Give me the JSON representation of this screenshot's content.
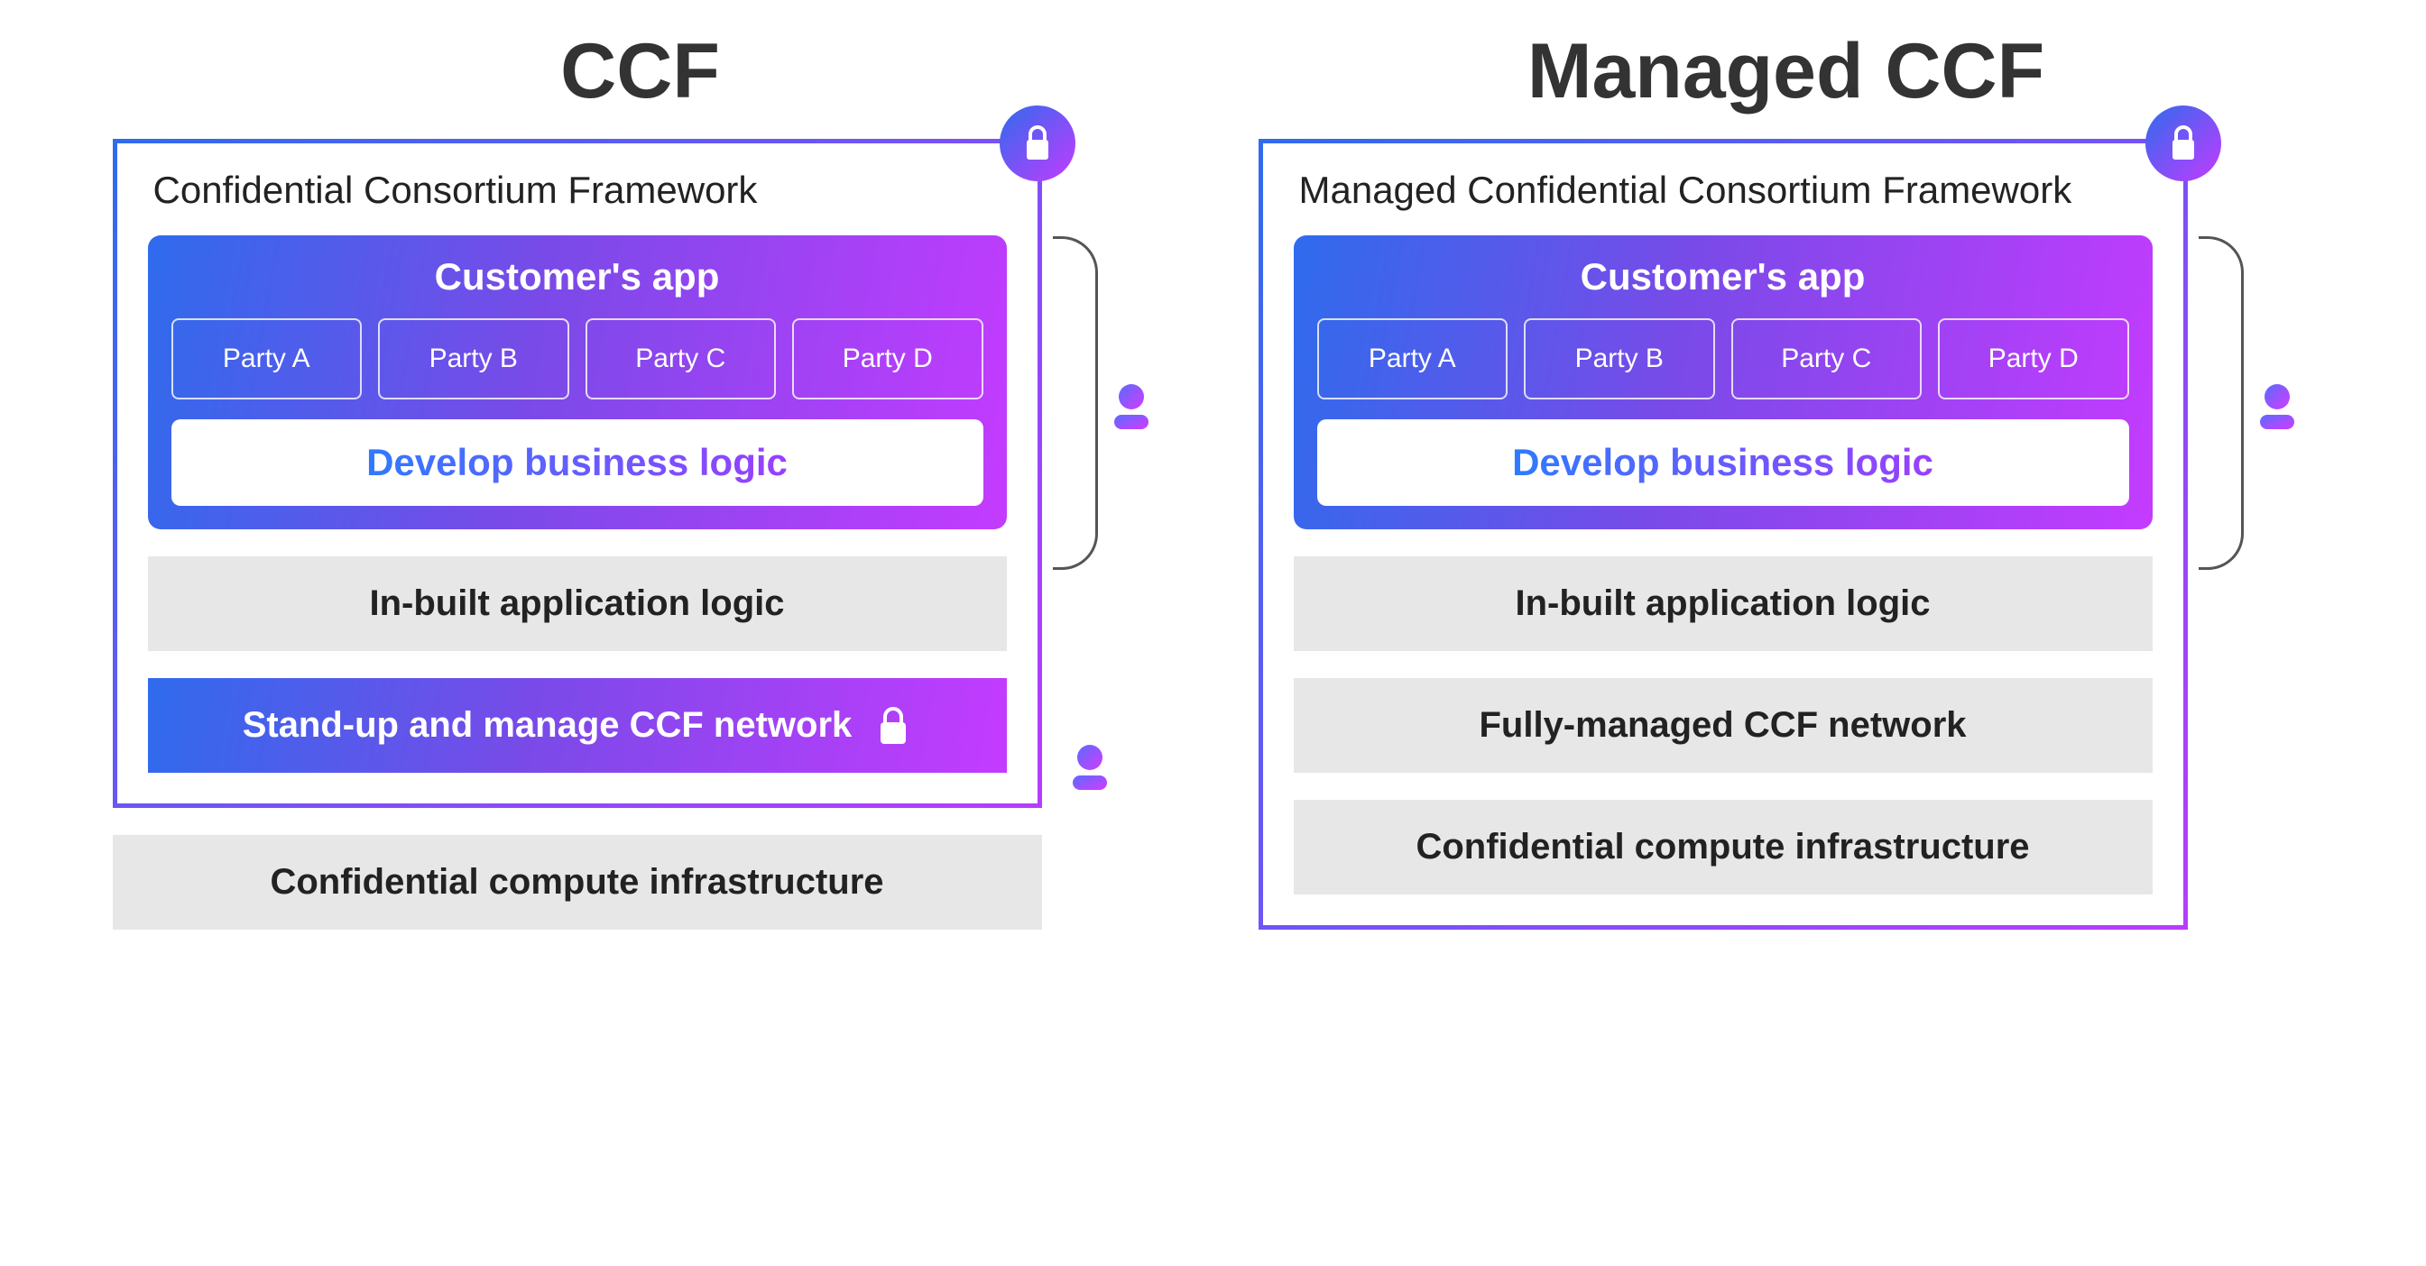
{
  "left": {
    "title": "CCF",
    "panel_title": "Confidential Consortium Framework",
    "app_title": "Customer's app",
    "parties": [
      "Party A",
      "Party B",
      "Party C",
      "Party D"
    ],
    "dev_logic": "Develop business logic",
    "inbuilt": "In-built application logic",
    "manage_network": "Stand-up and manage CCF network",
    "infra": "Confidential compute infrastructure"
  },
  "right": {
    "title": "Managed CCF",
    "panel_title": "Managed Confidential Consortium Framework",
    "app_title": "Customer's app",
    "parties": [
      "Party A",
      "Party B",
      "Party C",
      "Party D"
    ],
    "dev_logic": "Develop business logic",
    "inbuilt": "In-built application logic",
    "manage_network": "Fully-managed CCF network",
    "infra": "Confidential compute infrastructure"
  }
}
